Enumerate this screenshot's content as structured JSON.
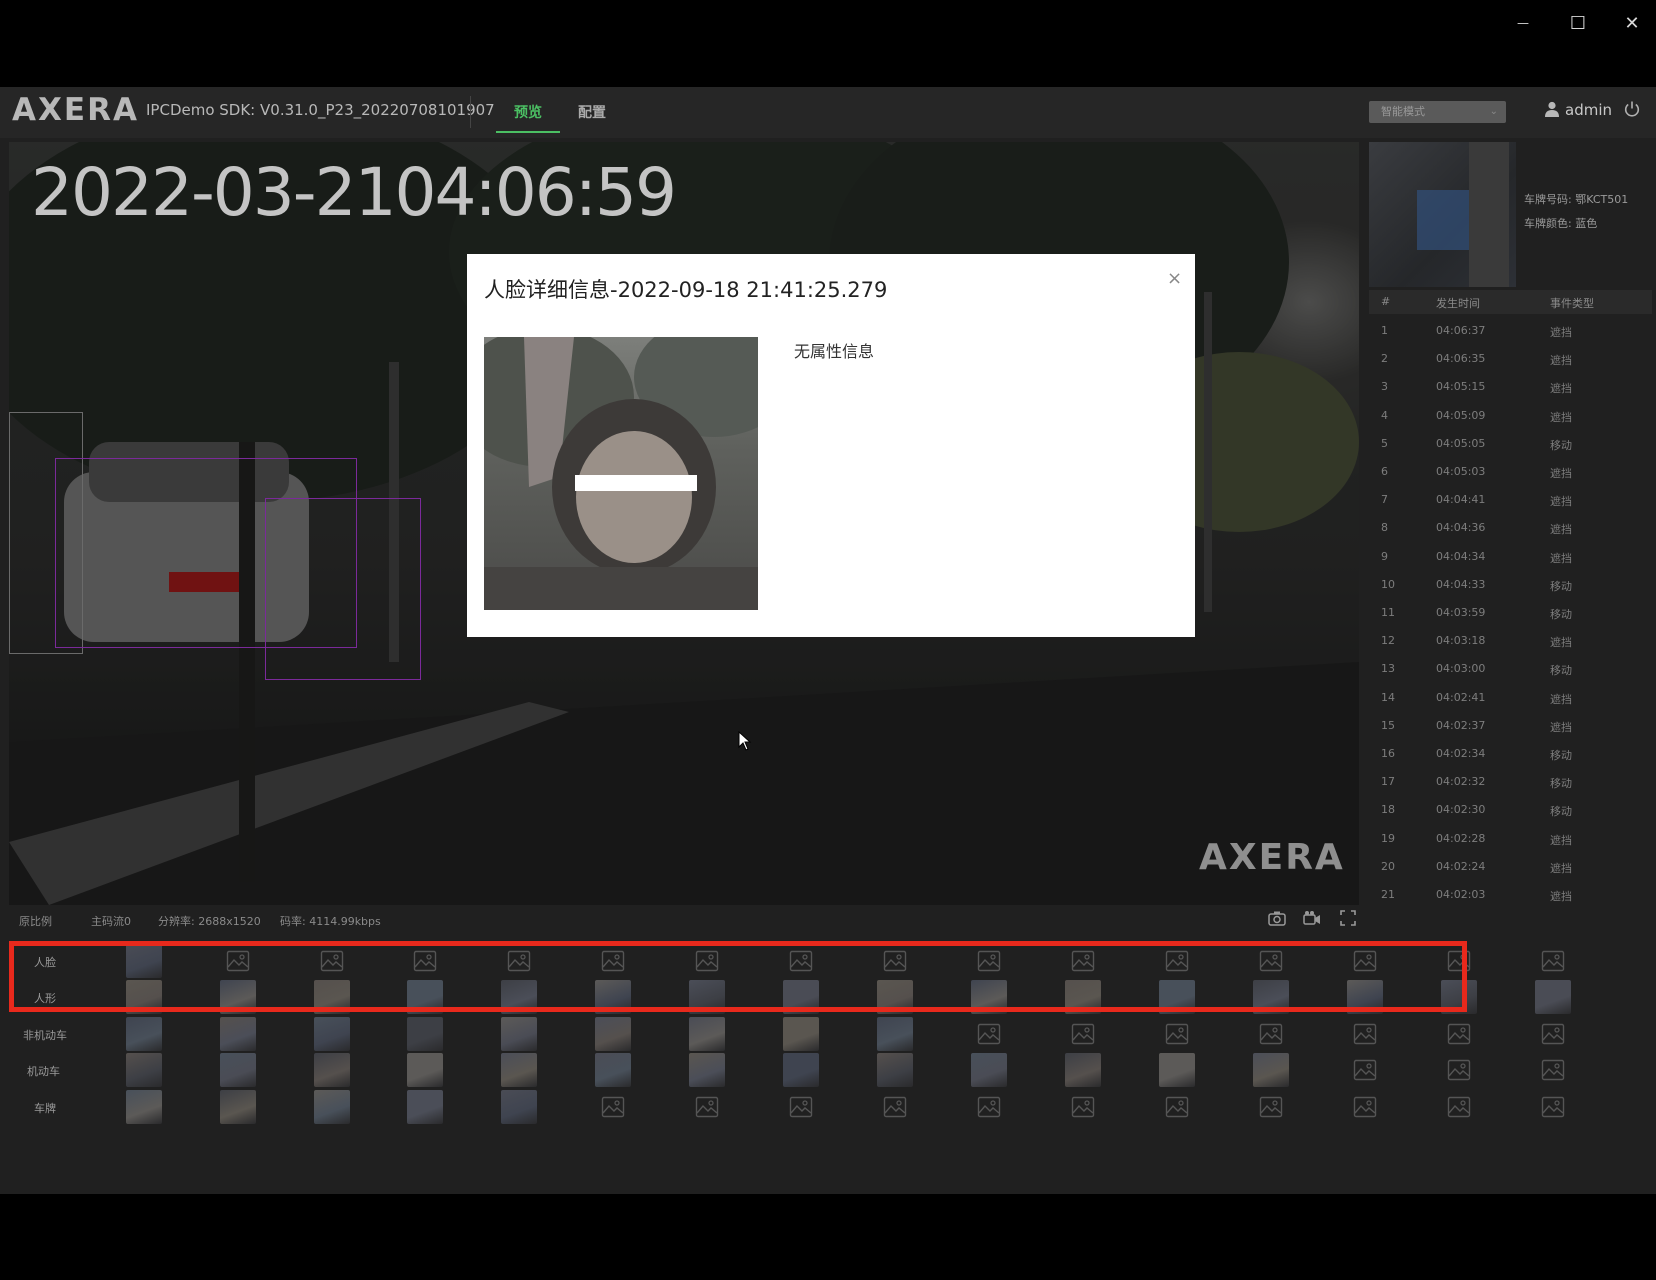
{
  "window": {
    "minimize_glyph": "—",
    "maximize_glyph": "☐",
    "close_glyph": "✕"
  },
  "header": {
    "logo": "AXERA",
    "sdk": "IPCDemo SDK: V0.31.0_P23_20220708101907",
    "tabs": [
      {
        "label": "预览",
        "active": true
      },
      {
        "label": "配置",
        "active": false
      }
    ],
    "mode_select": "智能模式",
    "user": "admin"
  },
  "video": {
    "osd_time": "2022-03-2104:06:59",
    "watermark": "AXERA",
    "status": {
      "ratio": "原比例",
      "stream": "主码流0",
      "resolution": "分辨率: 2688x1520",
      "bitrate": "码率: 4114.99kbps"
    }
  },
  "plate_panel": {
    "plate_number": "车牌号码: 鄂KCT501",
    "plate_color": "车牌颜色: 蓝色"
  },
  "events": {
    "columns": [
      "#",
      "发生时间",
      "事件类型"
    ],
    "rows": [
      [
        "1",
        "04:06:37",
        "遮挡"
      ],
      [
        "2",
        "04:06:35",
        "遮挡"
      ],
      [
        "3",
        "04:05:15",
        "遮挡"
      ],
      [
        "4",
        "04:05:09",
        "遮挡"
      ],
      [
        "5",
        "04:05:05",
        "移动"
      ],
      [
        "6",
        "04:05:03",
        "遮挡"
      ],
      [
        "7",
        "04:04:41",
        "遮挡"
      ],
      [
        "8",
        "04:04:36",
        "遮挡"
      ],
      [
        "9",
        "04:04:34",
        "遮挡"
      ],
      [
        "10",
        "04:04:33",
        "移动"
      ],
      [
        "11",
        "04:03:59",
        "移动"
      ],
      [
        "12",
        "04:03:18",
        "遮挡"
      ],
      [
        "13",
        "04:03:00",
        "移动"
      ],
      [
        "14",
        "04:02:41",
        "遮挡"
      ],
      [
        "15",
        "04:02:37",
        "遮挡"
      ],
      [
        "16",
        "04:02:34",
        "移动"
      ],
      [
        "17",
        "04:02:32",
        "移动"
      ],
      [
        "18",
        "04:02:30",
        "移动"
      ],
      [
        "19",
        "04:02:28",
        "遮挡"
      ],
      [
        "20",
        "04:02:24",
        "遮挡"
      ],
      [
        "21",
        "04:02:03",
        "遮挡"
      ]
    ]
  },
  "capture_rows": [
    {
      "label": "人脸",
      "filled": [
        0
      ]
    },
    {
      "label": "人形",
      "filled": [
        0,
        1,
        2,
        3,
        4,
        5,
        6,
        7,
        8,
        9,
        10,
        11,
        12,
        13,
        14,
        15
      ]
    },
    {
      "label": "非机动车",
      "filled": [
        0,
        1,
        2,
        3,
        4,
        5,
        6,
        7,
        8
      ]
    },
    {
      "label": "机动车",
      "filled": [
        0,
        1,
        2,
        3,
        4,
        5,
        6,
        7,
        8,
        9,
        10,
        11,
        12
      ]
    },
    {
      "label": "车牌",
      "filled": [
        0,
        1,
        2,
        3,
        4
      ]
    }
  ],
  "modal": {
    "title": "人脸详细信息-2022-09-18 21:41:25.279",
    "attr": "无属性信息",
    "close": "×"
  },
  "colors": {
    "accent": "#4bbf63",
    "highlight": "#e8291c",
    "bbox": "#7b2a9a"
  }
}
